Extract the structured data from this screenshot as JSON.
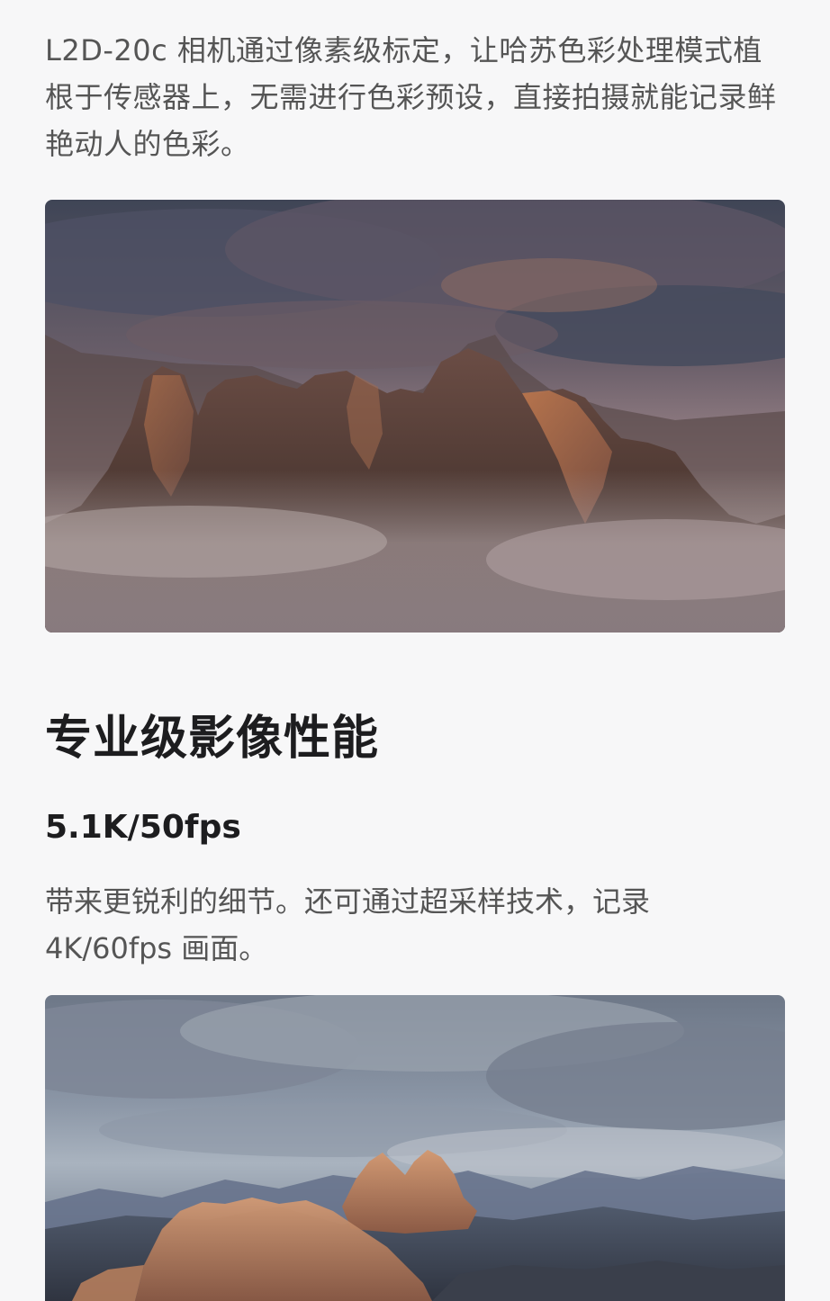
{
  "intro": {
    "text": "L2D-20c 相机通过像素级标定，让哈苏色彩处理模式植根于传感器上，无需进行色彩预设，直接拍摄就能记录鲜艳动人的色彩。"
  },
  "images": [
    {
      "subject": "misty-mountain-peaks-at-dusk"
    },
    {
      "subject": "sunlit-mountain-peaks-under-clouds"
    }
  ],
  "section": {
    "title": "专业级影像性能"
  },
  "spec": {
    "title": "5.1K/50fps",
    "body": "带来更锐利的细节。还可通过超采样技术，记录 4K/60fps 画面。"
  },
  "colors": {
    "background": "#f7f7f8",
    "heading": "#1d1d1f",
    "body_text": "#555555"
  }
}
